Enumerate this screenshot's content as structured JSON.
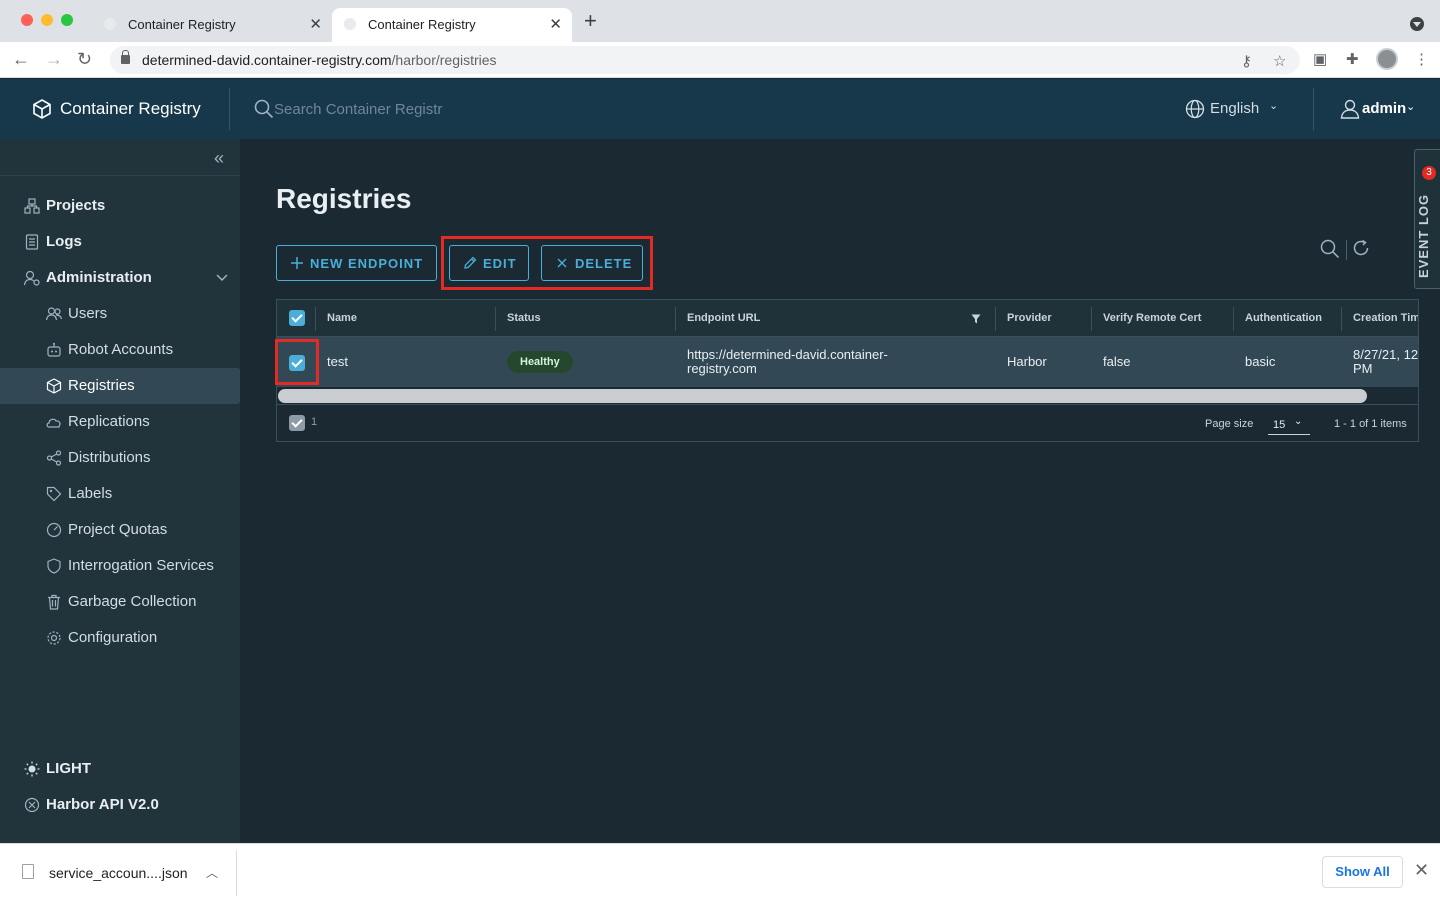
{
  "browser": {
    "tabs": [
      {
        "title": "Container Registry"
      },
      {
        "title": "Container Registry"
      }
    ],
    "new_tab_label": "+",
    "close_label": "✕",
    "url_host": "determined-david.container-registry.com",
    "url_path": "/harbor/registries"
  },
  "header": {
    "brand": "Container Registry",
    "search_placeholder": "Search Container Registr",
    "language": "English",
    "user": "admin"
  },
  "sidebar": {
    "items": [
      {
        "label": "Projects",
        "icon": "projects-icon"
      },
      {
        "label": "Logs",
        "icon": "logs-icon"
      },
      {
        "label": "Administration",
        "icon": "administration-icon"
      },
      {
        "label": "Users",
        "icon": "users-icon"
      },
      {
        "label": "Robot Accounts",
        "icon": "robot-icon"
      },
      {
        "label": "Registries",
        "icon": "registries-icon"
      },
      {
        "label": "Replications",
        "icon": "replications-icon"
      },
      {
        "label": "Distributions",
        "icon": "distributions-icon"
      },
      {
        "label": "Labels",
        "icon": "label-icon"
      },
      {
        "label": "Project Quotas",
        "icon": "quota-icon"
      },
      {
        "label": "Interrogation Services",
        "icon": "shield-icon"
      },
      {
        "label": "Garbage Collection",
        "icon": "trash-icon"
      },
      {
        "label": "Configuration",
        "icon": "gear-icon"
      }
    ],
    "theme_label": "LIGHT",
    "api_label": "Harbor API V2.0"
  },
  "main": {
    "title": "Registries",
    "buttons": {
      "new_endpoint": "NEW ENDPOINT",
      "edit": "EDIT",
      "delete": "DELETE"
    },
    "event_log": {
      "label": "EVENT LOG",
      "count": "3"
    },
    "table": {
      "columns": [
        "Name",
        "Status",
        "Endpoint URL",
        "Provider",
        "Verify Remote Cert",
        "Authentication",
        "Creation Tim"
      ],
      "rows": [
        {
          "name": "test",
          "status": "Healthy",
          "endpoint_line1": "https://determined-david.container-",
          "endpoint_line2": "registry.com",
          "provider": "Harbor",
          "verify_remote_cert": "false",
          "authentication": "basic",
          "creation_line1": "8/27/21, 12",
          "creation_line2": "PM"
        }
      ],
      "selected_count": "1",
      "page_size_label": "Page size",
      "page_size": "15",
      "pagination": "1 - 1 of 1 items"
    }
  },
  "downloads": {
    "file": "service_accoun....json",
    "show_all": "Show All"
  },
  "colors": {
    "header_bg": "#17374a",
    "sidebar_bg": "#21333b",
    "main_bg": "#1b2a32",
    "accent": "#4aaed9",
    "highlight": "#e12b24"
  }
}
